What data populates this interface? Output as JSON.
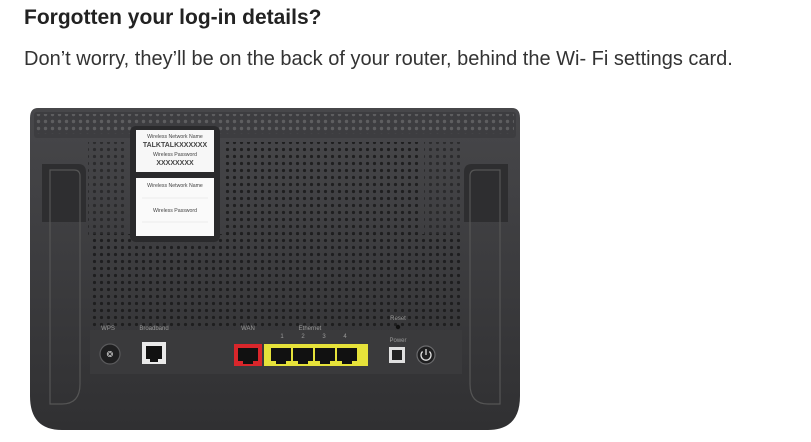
{
  "heading": "Forgotten your log-in details?",
  "body_text": "Don’t worry, they’ll be on the back of your router, behind the Wi- Fi settings card.",
  "router": {
    "card_top": {
      "network_name_label": "Wireless Network Name",
      "network_name_value": "TALKTALKXXXXXX",
      "password_label": "Wireless Password",
      "password_value": "XXXXXXXX"
    },
    "card_bottom": {
      "network_name_label": "Wireless Network Name",
      "password_label": "Wireless Password"
    },
    "ports": {
      "wps": "WPS",
      "broadband": "Broadband",
      "wan": "WAN",
      "ethernet": "Ethernet",
      "ethernet_numbers": [
        "1",
        "2",
        "3",
        "4"
      ],
      "reset": "Reset",
      "power": "Power"
    },
    "colors": {
      "body": "#3a3a3c",
      "wan_port": "#d9262b",
      "ethernet_ports": "#e6e23a",
      "port_hole": "#111111"
    }
  }
}
